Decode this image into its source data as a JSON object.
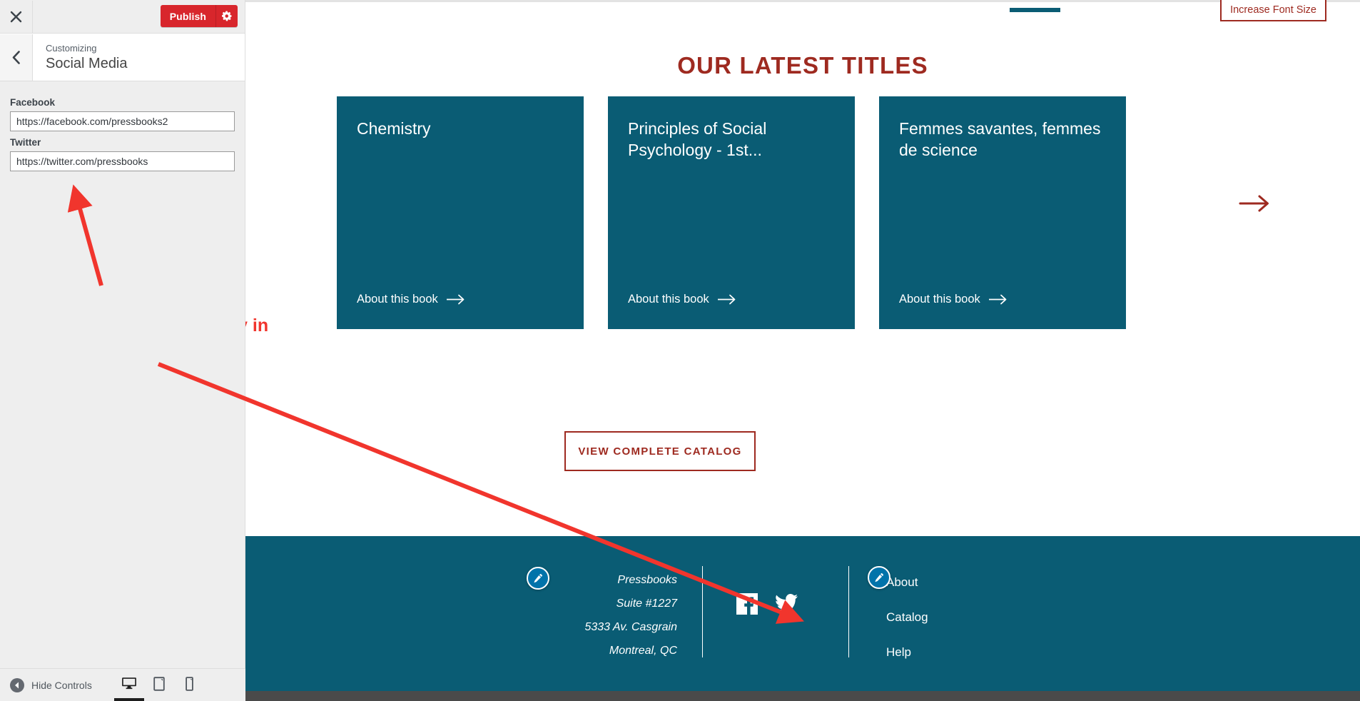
{
  "customizer": {
    "close_label": "×",
    "publish_label": "Publish",
    "gear_icon": "gear-icon",
    "back_icon": "chevron-left-icon",
    "eyebrow": "Customizing",
    "panel_title": "Social Media",
    "fields": [
      {
        "label": "Facebook",
        "value": "https://facebook.com/pressbooks2",
        "placeholder": "https://facebook.com/"
      },
      {
        "label": "Twitter",
        "value": "https://twitter.com/pressbooks",
        "placeholder": "https://twitter.com/"
      }
    ],
    "bottom": {
      "hide_controls_label": "Hide Controls",
      "collapse_icon": "collapse-left-icon",
      "devices": [
        {
          "name": "desktop",
          "icon": "desktop-icon",
          "active": true
        },
        {
          "name": "tablet",
          "icon": "tablet-icon",
          "active": false
        },
        {
          "name": "mobile",
          "icon": "mobile-icon",
          "active": false
        }
      ]
    }
  },
  "preview": {
    "increase_font_label": "Increase Font Size",
    "section_title": "OUR LATEST TITLES",
    "books": [
      {
        "title": "Chemistry",
        "link_label": "About this book"
      },
      {
        "title": "Principles of Social Psychology - 1st...",
        "link_label": "About this book"
      },
      {
        "title": "Femmes savantes, femmes de science",
        "link_label": "About this book"
      }
    ],
    "carousel_next_icon": "arrow-right-icon",
    "catalog_button_label": "VIEW COMPLETE CATALOG",
    "footer": {
      "address_lines": [
        "Pressbooks",
        "Suite #1227",
        "5333 Av. Casgrain",
        "Montreal, QC"
      ],
      "social": [
        {
          "name": "facebook",
          "icon": "facebook-icon"
        },
        {
          "name": "twitter",
          "icon": "twitter-icon"
        }
      ],
      "nav": [
        "About",
        "Catalog",
        "Help"
      ]
    }
  },
  "annotation": {
    "text": "Enter your social media handles. These will display in the footer."
  },
  "colors": {
    "teal": "#0a5c74",
    "dark_red": "#9e2a20",
    "publish_red": "#d8262c",
    "annotation_red": "#f1352d",
    "sidebar_bg": "#eeeeee",
    "edit_pin_blue": "#0073aa"
  }
}
